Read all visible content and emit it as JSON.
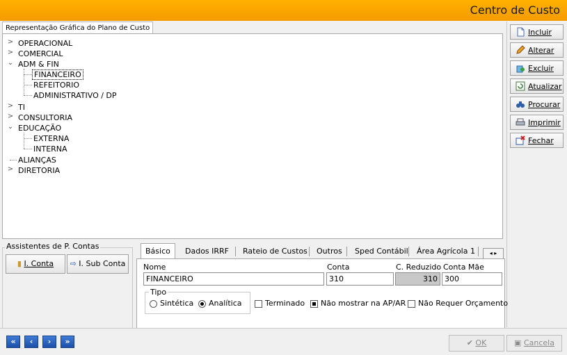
{
  "window": {
    "title": "Centro de Custo"
  },
  "tree": {
    "tab_label": "Representação Gráfica do Plano de Custo",
    "nodes": [
      {
        "label": "OPERACIONAL",
        "expanded": false
      },
      {
        "label": "COMERCIAL",
        "expanded": false
      },
      {
        "label": "ADM & FIN",
        "expanded": true,
        "children": [
          "FINANCEIRO",
          "REFEITORIO",
          "ADMINISTRATIVO / DP"
        ]
      },
      {
        "label": "TI",
        "expanded": false
      },
      {
        "label": "CONSULTORIA",
        "expanded": false
      },
      {
        "label": "EDUCAÇÃO",
        "expanded": true,
        "children": [
          "EXTERNA",
          "INTERNA"
        ]
      },
      {
        "label": "ALIANÇAS",
        "expanded": null
      },
      {
        "label": "DIRETORIA",
        "expanded": false
      }
    ],
    "selected": "FINANCEIRO"
  },
  "toolbar": {
    "incluir": "Incluir",
    "alterar": "Alterar",
    "excluir": "Excluir",
    "atualizar": "Atualizar",
    "procurar": "Procurar",
    "imprimir": "Imprimir",
    "fechar": "Fechar"
  },
  "assistants": {
    "label": "Assistentes de P. Contas",
    "i_conta": "I. Conta",
    "i_sub_conta": "I. Sub Conta"
  },
  "tabs": [
    "Básico",
    "Dados IRRF",
    "Rateio de Custos",
    "Outros",
    "Sped Contábil",
    "Área Agrícola 1"
  ],
  "form": {
    "nome_label": "Nome",
    "nome_value": "FINANCEIRO",
    "conta_label": "Conta",
    "conta_value": "310",
    "reduzido_label": "C. Reduzido",
    "reduzido_value": "310",
    "mae_label": "Conta Mãe",
    "mae_value": "300",
    "tipo_label": "Tipo",
    "sintetica": "Sintética",
    "analitica": "Analítica",
    "tipo_selected": "Analítica",
    "terminado": "Terminado",
    "terminado_checked": false,
    "nao_mostrar": "Não mostrar na AP/AR",
    "nao_mostrar_checked": true,
    "nao_requer": "Não Requer Orçamento",
    "nao_requer_checked": false
  },
  "footer": {
    "ok": "OK",
    "cancela": "Cancela"
  },
  "colors": {
    "titlebar": "#f7a600",
    "nav": "#2a62c2"
  }
}
